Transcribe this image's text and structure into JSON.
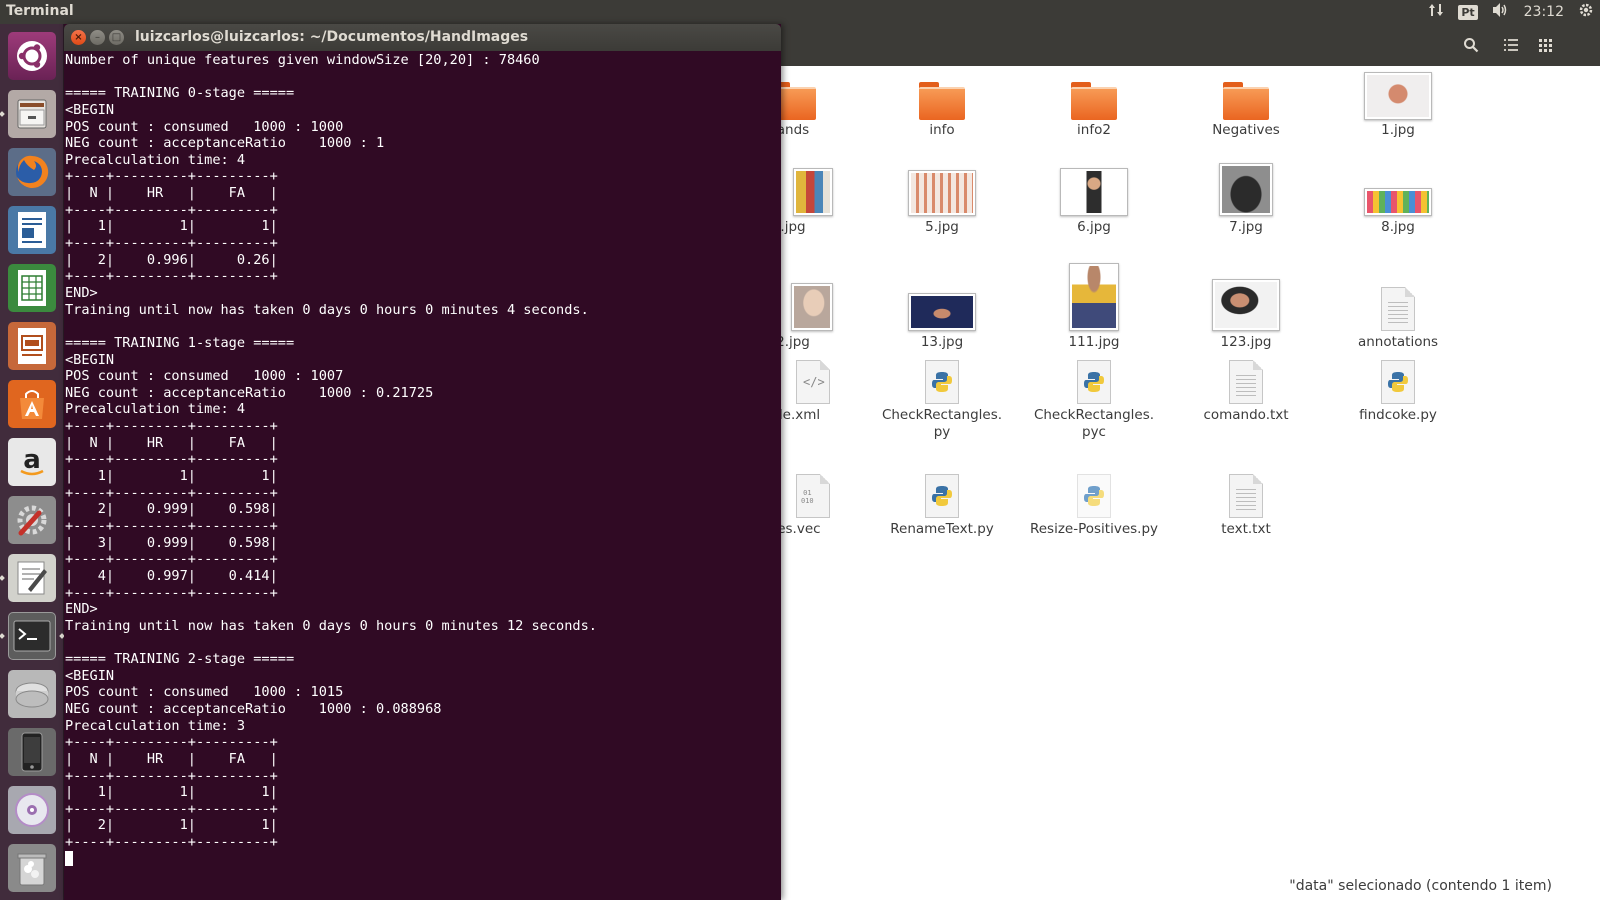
{
  "top_panel": {
    "app_title": "Terminal",
    "keyboard_layout": "Pt",
    "clock": "23:12",
    "icons": [
      "network-arrows-icon",
      "keyboard-layout-icon",
      "volume-icon",
      "power-gear-icon"
    ]
  },
  "launcher": {
    "items": [
      {
        "name": "ubuntu-dash",
        "icon": "ubuntu-logo-icon"
      },
      {
        "name": "files",
        "icon": "file-cabinet-icon"
      },
      {
        "name": "firefox",
        "icon": "firefox-icon"
      },
      {
        "name": "libreoffice-writer",
        "icon": "writer-document-icon"
      },
      {
        "name": "libreoffice-calc",
        "icon": "calc-spreadsheet-icon"
      },
      {
        "name": "libreoffice-impress",
        "icon": "impress-presentation-icon"
      },
      {
        "name": "software-center",
        "icon": "shopping-bag-icon"
      },
      {
        "name": "amazon",
        "icon": "amazon-logo-icon"
      },
      {
        "name": "system-settings",
        "icon": "settings-wrench-icon"
      },
      {
        "name": "text-editor",
        "icon": "text-editor-icon"
      },
      {
        "name": "terminal",
        "icon": "terminal-icon"
      },
      {
        "name": "disk",
        "icon": "hard-disk-icon"
      },
      {
        "name": "phone",
        "icon": "phone-icon"
      },
      {
        "name": "dvd",
        "icon": "optical-disc-icon"
      },
      {
        "name": "trash",
        "icon": "trash-icon"
      }
    ]
  },
  "terminal": {
    "window_title": "luizcarlos@luizcarlos: ~/Documentos/HandImages",
    "lines": [
      "Number of unique features given windowSize [20,20] : 78460",
      "",
      "===== TRAINING 0-stage =====",
      "<BEGIN",
      "POS count : consumed   1000 : 1000",
      "NEG count : acceptanceRatio    1000 : 1",
      "Precalculation time: 4",
      "+----+---------+---------+",
      "|  N |    HR   |    FA   |",
      "+----+---------+---------+",
      "|   1|        1|        1|",
      "+----+---------+---------+",
      "|   2|    0.996|     0.26|",
      "+----+---------+---------+",
      "END>",
      "Training until now has taken 0 days 0 hours 0 minutes 4 seconds.",
      "",
      "===== TRAINING 1-stage =====",
      "<BEGIN",
      "POS count : consumed   1000 : 1007",
      "NEG count : acceptanceRatio    1000 : 0.21725",
      "Precalculation time: 4",
      "+----+---------+---------+",
      "|  N |    HR   |    FA   |",
      "+----+---------+---------+",
      "|   1|        1|        1|",
      "+----+---------+---------+",
      "|   2|    0.999|    0.598|",
      "+----+---------+---------+",
      "|   3|    0.999|    0.598|",
      "+----+---------+---------+",
      "|   4|    0.997|    0.414|",
      "+----+---------+---------+",
      "END>",
      "Training until now has taken 0 days 0 hours 0 minutes 12 seconds.",
      "",
      "===== TRAINING 2-stage =====",
      "<BEGIN",
      "POS count : consumed   1000 : 1015",
      "NEG count : acceptanceRatio    1000 : 0.088968",
      "Precalculation time: 3",
      "+----+---------+---------+",
      "|  N |    HR   |    FA   |",
      "+----+---------+---------+",
      "|   1|        1|        1|",
      "+----+---------+---------+",
      "|   2|        1|        1|",
      "+----+---------+---------+"
    ]
  },
  "file_manager": {
    "header_icons": [
      "search-icon",
      "list-view-icon",
      "grid-view-icon"
    ],
    "files": [
      {
        "label": "ands",
        "icon": "folder-icon"
      },
      {
        "label": "info",
        "icon": "folder-icon"
      },
      {
        "label": "info2",
        "icon": "folder-icon"
      },
      {
        "label": "Negatives",
        "icon": "folder-icon"
      },
      {
        "label": "1.jpg",
        "icon": "image-thumbnail-icon"
      },
      {
        "label": ".jpg",
        "icon": "image-thumbnail-icon"
      },
      {
        "label": "5.jpg",
        "icon": "image-thumbnail-icon"
      },
      {
        "label": "6.jpg",
        "icon": "image-thumbnail-icon"
      },
      {
        "label": "7.jpg",
        "icon": "image-thumbnail-icon"
      },
      {
        "label": "8.jpg",
        "icon": "image-thumbnail-icon"
      },
      {
        "label": "2.jpg",
        "icon": "image-thumbnail-icon"
      },
      {
        "label": "13.jpg",
        "icon": "image-thumbnail-icon"
      },
      {
        "label": "111.jpg",
        "icon": "image-thumbnail-icon"
      },
      {
        "label": "123.jpg",
        "icon": "image-thumbnail-icon"
      },
      {
        "label": "annotations",
        "icon": "text-file-icon"
      },
      {
        "label": "ade.xml",
        "icon": "xml-file-icon"
      },
      {
        "label": "CheckRectangles.\npy",
        "icon": "python-file-icon"
      },
      {
        "label": "CheckRectangles.\npyc",
        "icon": "python-file-icon"
      },
      {
        "label": "comando.txt",
        "icon": "text-file-icon"
      },
      {
        "label": "findcoke.py",
        "icon": "python-file-icon"
      },
      {
        "label": "ives.vec",
        "icon": "binary-file-icon"
      },
      {
        "label": "RenameText.py",
        "icon": "python-file-icon"
      },
      {
        "label": "Resize-Positives.py",
        "icon": "python-file-icon"
      },
      {
        "label": "text.txt",
        "icon": "text-file-icon"
      }
    ],
    "status": "\"data\" selecionado  (contendo 1 item)"
  },
  "colors": {
    "terminal_bg": "#300a24",
    "panel_bg": "#3c3b37",
    "launcher_bg": "#412c3c",
    "folder_orange": "#ef7a33",
    "close_button": "#e8541e"
  }
}
